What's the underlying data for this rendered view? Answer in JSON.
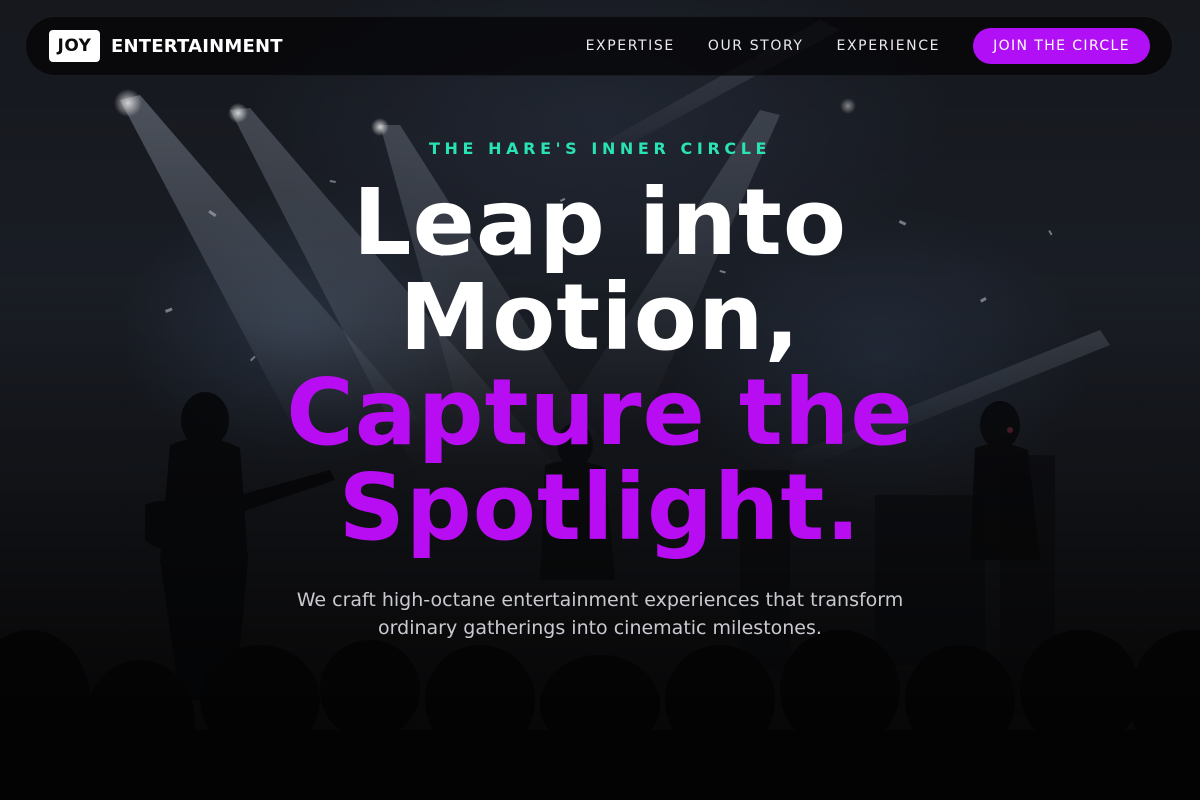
{
  "nav": {
    "brand_badge": "JOY",
    "brand_name": "ENTERTAINMENT",
    "links": [
      "EXPERTISE",
      "OUR STORY",
      "EXPERIENCE"
    ],
    "cta": "JOIN THE CIRCLE"
  },
  "hero": {
    "eyebrow": "THE HARE'S INNER CIRCLE",
    "headline_lines": [
      "Leap into",
      "Motion,",
      "Capture the",
      "Spotlight."
    ],
    "subtitle_lines": [
      "We craft high-octane entertainment experiences that transform",
      "ordinary gatherings into cinematic milestones."
    ]
  },
  "colors": {
    "accent_purple": "#b80cf2",
    "accent_teal": "#29e3b5",
    "cta_bg": "#b10ff5"
  },
  "background_image": "concert-stage-silhouette"
}
